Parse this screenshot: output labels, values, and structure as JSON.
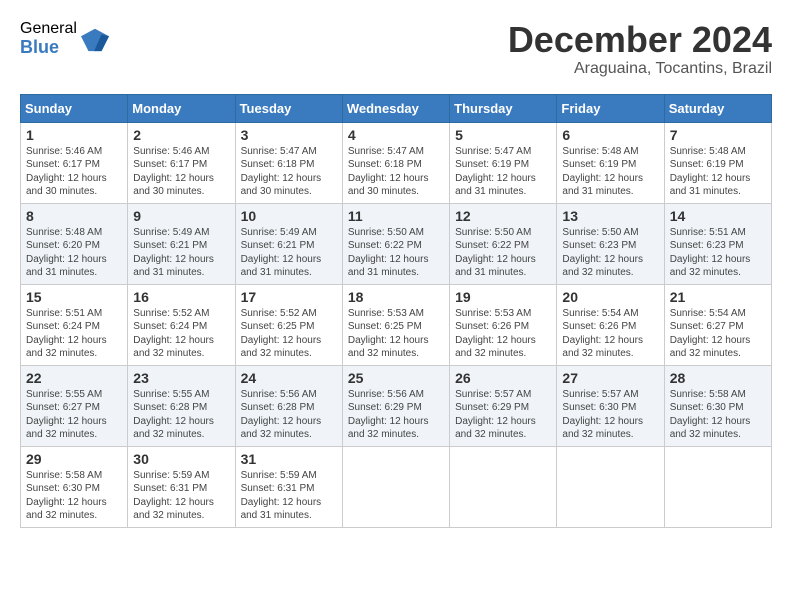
{
  "logo": {
    "general": "General",
    "blue": "Blue"
  },
  "title": {
    "month_year": "December 2024",
    "location": "Araguaina, Tocantins, Brazil"
  },
  "weekdays": [
    "Sunday",
    "Monday",
    "Tuesday",
    "Wednesday",
    "Thursday",
    "Friday",
    "Saturday"
  ],
  "weeks": [
    [
      {
        "day": "1",
        "sunrise": "5:46 AM",
        "sunset": "6:17 PM",
        "daylight": "12 hours and 30 minutes."
      },
      {
        "day": "2",
        "sunrise": "5:46 AM",
        "sunset": "6:17 PM",
        "daylight": "12 hours and 30 minutes."
      },
      {
        "day": "3",
        "sunrise": "5:47 AM",
        "sunset": "6:18 PM",
        "daylight": "12 hours and 30 minutes."
      },
      {
        "day": "4",
        "sunrise": "5:47 AM",
        "sunset": "6:18 PM",
        "daylight": "12 hours and 30 minutes."
      },
      {
        "day": "5",
        "sunrise": "5:47 AM",
        "sunset": "6:19 PM",
        "daylight": "12 hours and 31 minutes."
      },
      {
        "day": "6",
        "sunrise": "5:48 AM",
        "sunset": "6:19 PM",
        "daylight": "12 hours and 31 minutes."
      },
      {
        "day": "7",
        "sunrise": "5:48 AM",
        "sunset": "6:19 PM",
        "daylight": "12 hours and 31 minutes."
      }
    ],
    [
      {
        "day": "8",
        "sunrise": "5:48 AM",
        "sunset": "6:20 PM",
        "daylight": "12 hours and 31 minutes."
      },
      {
        "day": "9",
        "sunrise": "5:49 AM",
        "sunset": "6:21 PM",
        "daylight": "12 hours and 31 minutes."
      },
      {
        "day": "10",
        "sunrise": "5:49 AM",
        "sunset": "6:21 PM",
        "daylight": "12 hours and 31 minutes."
      },
      {
        "day": "11",
        "sunrise": "5:50 AM",
        "sunset": "6:22 PM",
        "daylight": "12 hours and 31 minutes."
      },
      {
        "day": "12",
        "sunrise": "5:50 AM",
        "sunset": "6:22 PM",
        "daylight": "12 hours and 31 minutes."
      },
      {
        "day": "13",
        "sunrise": "5:50 AM",
        "sunset": "6:23 PM",
        "daylight": "12 hours and 32 minutes."
      },
      {
        "day": "14",
        "sunrise": "5:51 AM",
        "sunset": "6:23 PM",
        "daylight": "12 hours and 32 minutes."
      }
    ],
    [
      {
        "day": "15",
        "sunrise": "5:51 AM",
        "sunset": "6:24 PM",
        "daylight": "12 hours and 32 minutes."
      },
      {
        "day": "16",
        "sunrise": "5:52 AM",
        "sunset": "6:24 PM",
        "daylight": "12 hours and 32 minutes."
      },
      {
        "day": "17",
        "sunrise": "5:52 AM",
        "sunset": "6:25 PM",
        "daylight": "12 hours and 32 minutes."
      },
      {
        "day": "18",
        "sunrise": "5:53 AM",
        "sunset": "6:25 PM",
        "daylight": "12 hours and 32 minutes."
      },
      {
        "day": "19",
        "sunrise": "5:53 AM",
        "sunset": "6:26 PM",
        "daylight": "12 hours and 32 minutes."
      },
      {
        "day": "20",
        "sunrise": "5:54 AM",
        "sunset": "6:26 PM",
        "daylight": "12 hours and 32 minutes."
      },
      {
        "day": "21",
        "sunrise": "5:54 AM",
        "sunset": "6:27 PM",
        "daylight": "12 hours and 32 minutes."
      }
    ],
    [
      {
        "day": "22",
        "sunrise": "5:55 AM",
        "sunset": "6:27 PM",
        "daylight": "12 hours and 32 minutes."
      },
      {
        "day": "23",
        "sunrise": "5:55 AM",
        "sunset": "6:28 PM",
        "daylight": "12 hours and 32 minutes."
      },
      {
        "day": "24",
        "sunrise": "5:56 AM",
        "sunset": "6:28 PM",
        "daylight": "12 hours and 32 minutes."
      },
      {
        "day": "25",
        "sunrise": "5:56 AM",
        "sunset": "6:29 PM",
        "daylight": "12 hours and 32 minutes."
      },
      {
        "day": "26",
        "sunrise": "5:57 AM",
        "sunset": "6:29 PM",
        "daylight": "12 hours and 32 minutes."
      },
      {
        "day": "27",
        "sunrise": "5:57 AM",
        "sunset": "6:30 PM",
        "daylight": "12 hours and 32 minutes."
      },
      {
        "day": "28",
        "sunrise": "5:58 AM",
        "sunset": "6:30 PM",
        "daylight": "12 hours and 32 minutes."
      }
    ],
    [
      {
        "day": "29",
        "sunrise": "5:58 AM",
        "sunset": "6:30 PM",
        "daylight": "12 hours and 32 minutes."
      },
      {
        "day": "30",
        "sunrise": "5:59 AM",
        "sunset": "6:31 PM",
        "daylight": "12 hours and 32 minutes."
      },
      {
        "day": "31",
        "sunrise": "5:59 AM",
        "sunset": "6:31 PM",
        "daylight": "12 hours and 31 minutes."
      },
      null,
      null,
      null,
      null
    ]
  ],
  "labels": {
    "sunrise": "Sunrise:",
    "sunset": "Sunset:",
    "daylight": "Daylight:"
  }
}
